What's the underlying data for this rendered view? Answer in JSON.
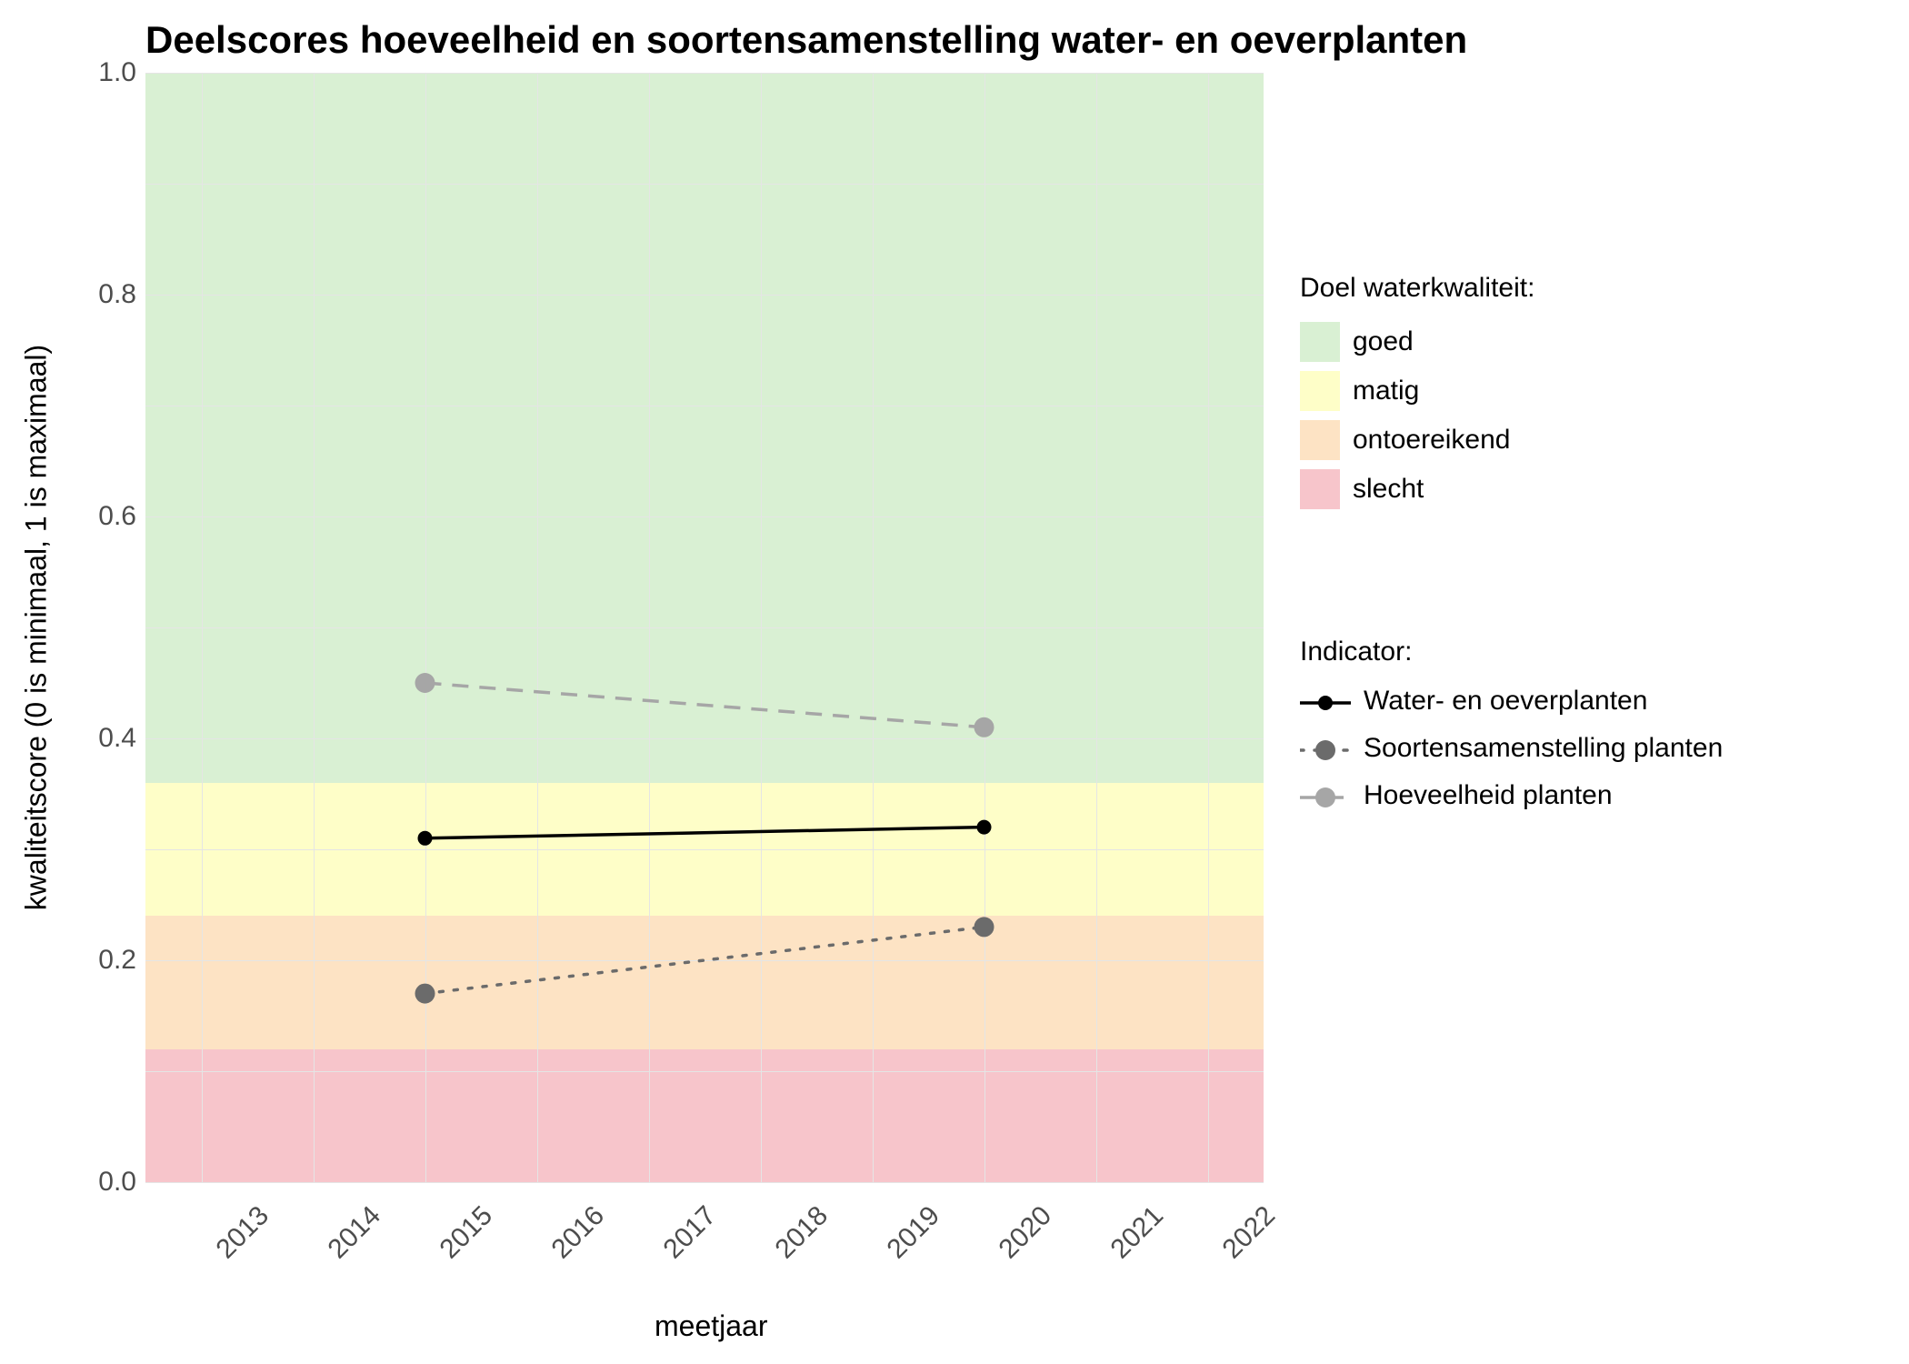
{
  "chart_data": {
    "type": "line",
    "title": "Deelscores hoeveelheid en soortensamenstelling water- en oeverplanten",
    "xlabel": "meetjaar",
    "ylabel": "kwaliteitscore (0 is minimaal, 1 is maximaal)",
    "x_range": [
      2012.5,
      2022.5
    ],
    "y_range": [
      0.0,
      1.0
    ],
    "x_ticks": [
      2013,
      2014,
      2015,
      2016,
      2017,
      2018,
      2019,
      2020,
      2021,
      2022
    ],
    "y_ticks": [
      0.0,
      0.2,
      0.4,
      0.6,
      0.8,
      1.0
    ],
    "bands": [
      {
        "name": "slecht",
        "ymin": 0.0,
        "ymax": 0.12,
        "color": "#f7c5cb"
      },
      {
        "name": "ontoereikend",
        "ymin": 0.12,
        "ymax": 0.24,
        "color": "#fde3c4"
      },
      {
        "name": "matig",
        "ymin": 0.24,
        "ymax": 0.36,
        "color": "#fefec8"
      },
      {
        "name": "goed",
        "ymin": 0.36,
        "ymax": 1.0,
        "color": "#d9f0d3"
      }
    ],
    "series": [
      {
        "name": "Water- en oeverplanten",
        "x": [
          2015,
          2020
        ],
        "y": [
          0.31,
          0.32
        ],
        "color": "#000000",
        "dash": "solid",
        "marker_r": 8
      },
      {
        "name": "Soortensamenstelling planten",
        "x": [
          2015,
          2020
        ],
        "y": [
          0.17,
          0.23
        ],
        "color": "#6b6b6b",
        "dash": "dotted",
        "marker_r": 11
      },
      {
        "name": "Hoeveelheid planten",
        "x": [
          2015,
          2020
        ],
        "y": [
          0.45,
          0.41
        ],
        "color": "#a6a6a6",
        "dash": "dashed",
        "marker_r": 11
      }
    ]
  },
  "legend1": {
    "title": "Doel waterkwaliteit:",
    "items": [
      {
        "label": "goed",
        "color": "#d9f0d3"
      },
      {
        "label": "matig",
        "color": "#fefec8"
      },
      {
        "label": "ontoereikend",
        "color": "#fde3c4"
      },
      {
        "label": "slecht",
        "color": "#f7c5cb"
      }
    ]
  },
  "legend2": {
    "title": "Indicator:",
    "items": [
      {
        "label": "Water- en oeverplanten",
        "color": "#000000",
        "dash": "solid",
        "marker_r": 8
      },
      {
        "label": "Soortensamenstelling planten",
        "color": "#6b6b6b",
        "dash": "dotted",
        "marker_r": 11
      },
      {
        "label": "Hoeveelheid planten",
        "color": "#a6a6a6",
        "dash": "dashed",
        "marker_r": 11
      }
    ]
  }
}
